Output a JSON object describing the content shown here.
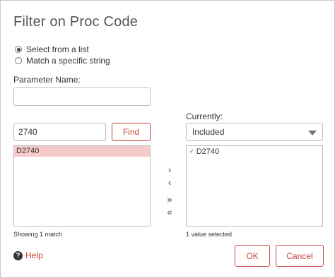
{
  "dialog": {
    "title": "Filter on Proc Code"
  },
  "mode": {
    "options": [
      {
        "label": "Select from a list",
        "selected": true
      },
      {
        "label": "Match a specific string",
        "selected": false
      }
    ]
  },
  "parameter": {
    "label": "Parameter Name:",
    "value": ""
  },
  "search": {
    "value": "2740",
    "find_label": "Find",
    "status": "Showing 1 match"
  },
  "results": {
    "items": [
      "D2740"
    ]
  },
  "movers": {
    "add": "›",
    "remove": "‹",
    "add_all": "»",
    "remove_all": "«"
  },
  "current": {
    "label": "Currently:",
    "selected_option": "Included",
    "items": [
      {
        "check": "✓",
        "label": "D2740"
      }
    ],
    "status": "1 value selected"
  },
  "footer": {
    "help_icon": "?",
    "help_label": "Help",
    "ok_label": "OK",
    "cancel_label": "Cancel"
  },
  "colors": {
    "accent": "#c9453f",
    "selection": "#f6caca"
  }
}
